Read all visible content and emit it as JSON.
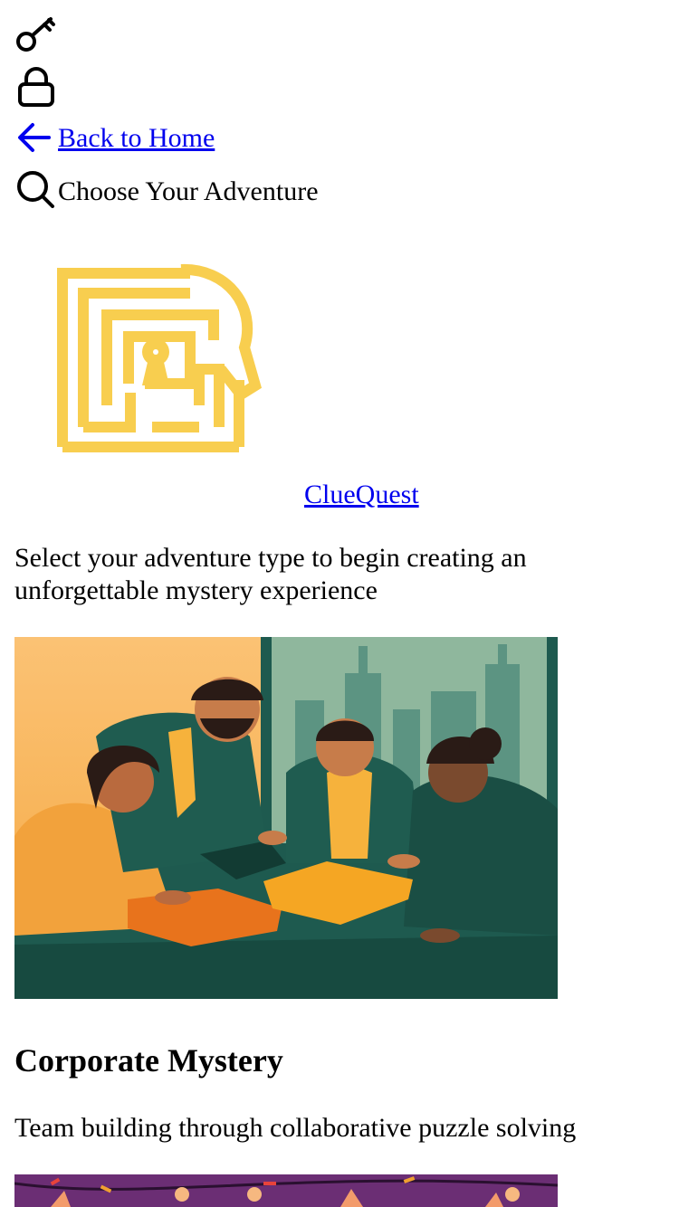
{
  "icons": {
    "top1": "key-icon",
    "top2": "lock-icon",
    "back": "arrow-left-icon",
    "search": "search-icon"
  },
  "nav": {
    "back_label": "Back to Home",
    "page_title": "Choose Your Adventure"
  },
  "brand": {
    "name": "ClueQuest",
    "logo": "maze-keyhole-magnifier-logo",
    "logo_color": "#F8CE4F"
  },
  "intro": {
    "description": "Select your adventure type to begin creating an unforgettable mystery experience"
  },
  "adventures": [
    {
      "title": "Corporate Mystery",
      "description": "Team building through collaborative puzzle solving",
      "image": "team-assembling-puzzle-illustration"
    },
    {
      "title": "",
      "description": "",
      "image": "party-celebration-illustration"
    }
  ],
  "colors": {
    "link": "#0000EE",
    "accent_orange": "#F4A23A",
    "accent_green": "#1E5A4F",
    "party_purple": "#6B2E74"
  }
}
